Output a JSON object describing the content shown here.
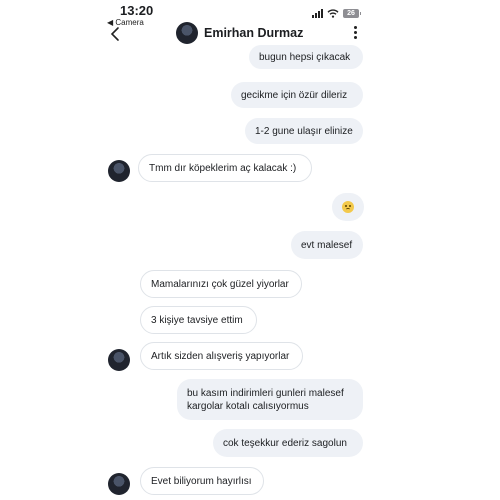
{
  "status_bar": {
    "time": "13:20",
    "back_app": "◀ Camera",
    "battery": "26"
  },
  "header": {
    "contact_name": "Emirhan Durmaz",
    "back_icon": "chevron-left-icon",
    "menu_icon": "more-vertical-icon"
  },
  "messages": [
    {
      "direction": "outgoing",
      "text": "bugun hepsi çıkacak"
    },
    {
      "direction": "outgoing",
      "text": "gecikme için özür dileriz"
    },
    {
      "direction": "outgoing",
      "text": "1-2 gune ulaşır elinize"
    },
    {
      "direction": "incoming",
      "text": "Tmm dır köpeklerim aç kalacak :)"
    },
    {
      "direction": "outgoing",
      "emoji": "disappointed-face-icon"
    },
    {
      "direction": "outgoing",
      "text": "evt malesef"
    },
    {
      "direction": "incoming",
      "text": "Mamalarınızı çok güzel yiyorlar"
    },
    {
      "direction": "incoming",
      "text": "3 kişiye tavsiye ettim"
    },
    {
      "direction": "incoming",
      "text": "Artık sizden alışveriş yapıyorlar"
    },
    {
      "direction": "outgoing",
      "text": "bu kasım indirimleri gunleri malesef kargolar kotalı calısıyormus"
    },
    {
      "direction": "outgoing",
      "text": "cok teşekkur ederiz sagolun"
    },
    {
      "direction": "incoming",
      "text": "Evet biliyorum hayırlısı"
    }
  ]
}
